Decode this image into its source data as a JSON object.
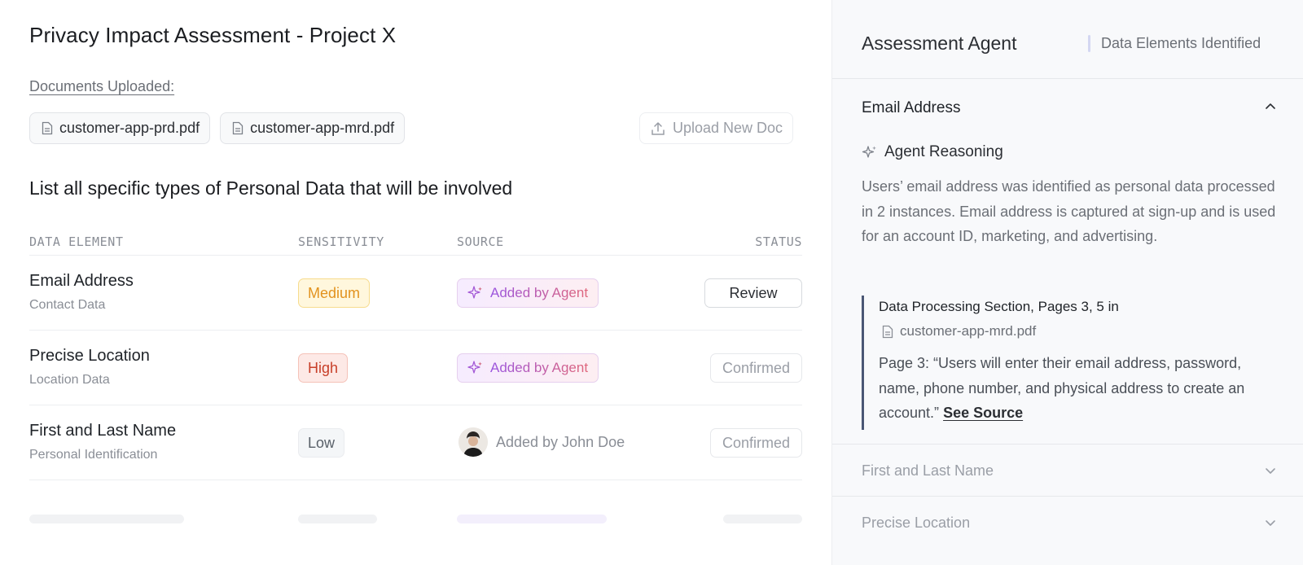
{
  "page": {
    "title": "Privacy Impact Assessment - Project X",
    "docs_label": "Documents Uploaded:",
    "documents": [
      {
        "name": "customer-app-prd.pdf"
      },
      {
        "name": "customer-app-mrd.pdf"
      }
    ],
    "upload_label": "Upload New Doc",
    "question": "List all specific types of Personal Data that will be involved"
  },
  "table": {
    "headers": [
      "DATA ELEMENT",
      "SENSITIVITY",
      "SOURCE",
      "STATUS"
    ],
    "rows": [
      {
        "name": "Email Address",
        "category": "Contact Data",
        "sensitivity": "Medium",
        "source": "Added by Agent",
        "status": "Review"
      },
      {
        "name": "Precise Location",
        "category": "Location Data",
        "sensitivity": "High",
        "source": "Added by Agent",
        "status": "Confirmed"
      },
      {
        "name": "First and Last Name",
        "category": "Personal Identification",
        "sensitivity": "Low",
        "source": "Added by John Doe",
        "status": "Confirmed"
      }
    ]
  },
  "agent": {
    "title": "Assessment Agent",
    "subtitle": "Data Elements Identified",
    "open_item": {
      "title": "Email Address",
      "reasoning_label": "Agent Reasoning",
      "reasoning_text": "Users’ email address was identified as personal data processed in 2 instances. Email address is captured at sign-up and is used for an account ID, marketing, and advertising.",
      "quote_title": "Data Processing Section, Pages 3, 5 in",
      "quote_doc": "customer-app-mrd.pdf",
      "quote_body": "Page 3: “Users will enter their email address, password, name, phone number, and physical address to create an account.”",
      "see_source": "See Source"
    },
    "collapsed_items": [
      "First and Last Name",
      "Precise Location"
    ]
  },
  "colors": {
    "accent_agent": "#9a54c9",
    "medium": "#e2921e",
    "high": "#c8402a",
    "quote_border": "#4a5775"
  },
  "icons": [
    "document-icon",
    "upload-icon",
    "sparkle-icon",
    "chevron-up-icon",
    "chevron-down-icon"
  ]
}
